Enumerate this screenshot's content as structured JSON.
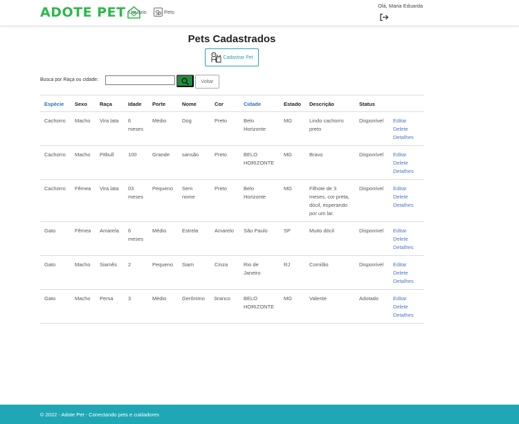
{
  "navbar": {
    "logo_text": "ADOTE PET",
    "logo_icon": "house-heart-icon",
    "usuario_label": "Usuário",
    "pets_label": "Pets",
    "greeting": "Olá, Maria Eduarda",
    "logout_icon": "logout-icon",
    "brand_color": "#2db84b"
  },
  "main": {
    "title": "Pets Cadastrados",
    "cadastrar_label": "Cadastrar Pet",
    "cadastrar_icon": "dog-cat-icon",
    "search": {
      "label": "Busca por Raça ou cidade:",
      "value": "",
      "placeholder": "",
      "button_icon": "search-icon",
      "voltar_label": "Voltar"
    }
  },
  "table": {
    "headers": [
      "Espécie",
      "Sexo",
      "Raça",
      "Idade",
      "Porte",
      "Nome",
      "Cor",
      "Cidade",
      "Estado",
      "Descrição",
      "Status"
    ],
    "link_headers": [
      "Espécie",
      "Cidade"
    ],
    "rows": [
      {
        "especie": "Cachorro",
        "sexo": "Macho",
        "raca": "Vira lata",
        "idade": "6 meses",
        "porte": "Médio",
        "nome": "Dog",
        "cor": "Preto",
        "cidade": "Belo Horizonte",
        "estado": "MG",
        "descricao": "Lindo cachorro preto",
        "status": "Disponível"
      },
      {
        "especie": "Cachorro",
        "sexo": "Macho",
        "raca": "Pitbull",
        "idade": "100",
        "porte": "Grande",
        "nome": "sansão",
        "cor": "Preto",
        "cidade": "BELO HORIZONTE",
        "estado": "MG",
        "descricao": "Bravo",
        "status": "Disponível"
      },
      {
        "especie": "Cachorro",
        "sexo": "Fêmea",
        "raca": "Vira lata",
        "idade": "03 meses",
        "porte": "Pequeno",
        "nome": "Sem nome",
        "cor": "Preto",
        "cidade": "Belo Horizonte",
        "estado": "MG",
        "descricao": "Filhote de 3 meses, cor preta, dócil, esperando por um lar.",
        "status": "Disponível"
      },
      {
        "especie": "Gato",
        "sexo": "Fêmea",
        "raca": "Amarela",
        "idade": "6 meses",
        "porte": "Médio",
        "nome": "Estrela",
        "cor": "Amarelo",
        "cidade": "São Paulo",
        "estado": "SP",
        "descricao": "Muito dócil",
        "status": "Disponível"
      },
      {
        "especie": "Gato",
        "sexo": "Macho",
        "raca": "Siamês",
        "idade": "2",
        "porte": "Pequeno",
        "nome": "Siam",
        "cor": "Cinza",
        "cidade": "Rio de Janeiro",
        "estado": "RJ",
        "descricao": "Comilão",
        "status": "Disponível"
      },
      {
        "especie": "Gato",
        "sexo": "Macho",
        "raca": "Persa",
        "idade": "3",
        "porte": "Médio",
        "nome": "Gerônimo",
        "cor": "branco",
        "cidade": "BELO HORIZONTE",
        "estado": "MG",
        "descricao": "Valente",
        "status": "Adotado"
      }
    ],
    "actions": [
      "Editar",
      "Delete",
      "Detalhes"
    ]
  },
  "footer": {
    "text": "© 2022 - Adote Pet - Conectando pets e cuidadores",
    "color": "#1fa7b6"
  }
}
